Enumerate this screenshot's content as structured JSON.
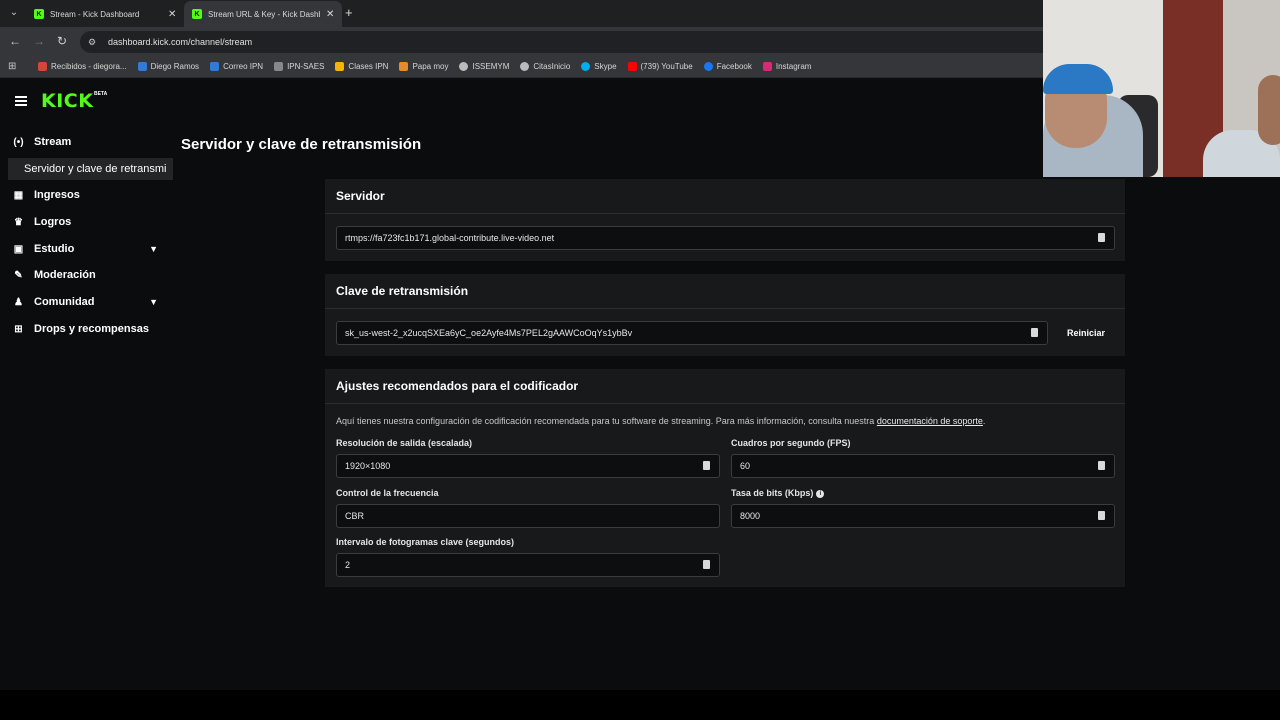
{
  "browser": {
    "tabs": [
      {
        "title": "Stream - Kick Dashboard",
        "active": false
      },
      {
        "title": "Stream URL & Key - Kick Dashb",
        "active": true
      }
    ],
    "url": "dashboard.kick.com/channel/stream",
    "bookmarks": [
      {
        "label": "Recibidos - diegora...",
        "color": "#d44638"
      },
      {
        "label": "Diego Ramos",
        "color": "#2f7bd6"
      },
      {
        "label": "Correo IPN",
        "color": "#2f7bd6"
      },
      {
        "label": "IPN-SAES",
        "color": "#888888"
      },
      {
        "label": "Clases IPN",
        "color": "#f4b400"
      },
      {
        "label": "Papa moy",
        "color": "#e58b2a"
      },
      {
        "label": "ISSEMYM",
        "color": "#bbbbbb"
      },
      {
        "label": "CitasInicio",
        "color": "#bbbbbb"
      },
      {
        "label": "Skype",
        "color": "#00aff0"
      },
      {
        "label": "(739) YouTube",
        "color": "#ff0000"
      },
      {
        "label": "Facebook",
        "color": "#1877f2"
      },
      {
        "label": "Instagram",
        "color": "#d62976"
      }
    ]
  },
  "kick": {
    "logo": "KICK",
    "logo_badge": "BETA",
    "sidebar": {
      "items": [
        {
          "label": "Stream",
          "icon": "broadcast-icon",
          "glyph": "(•)"
        },
        {
          "label": "Ingresos",
          "icon": "chart-icon",
          "glyph": "▦"
        },
        {
          "label": "Logros",
          "icon": "trophy-icon",
          "glyph": "♛"
        },
        {
          "label": "Estudio",
          "icon": "studio-icon",
          "glyph": "▣"
        },
        {
          "label": "Moderación",
          "icon": "wrench-icon",
          "glyph": "✎"
        },
        {
          "label": "Comunidad",
          "icon": "community-icon",
          "glyph": "♟"
        },
        {
          "label": "Drops y recompensas",
          "icon": "drops-icon",
          "glyph": "⊞"
        }
      ],
      "sub_item": "Servidor y clave de retransmi"
    },
    "page_title": "Servidor y clave de retransmisión",
    "server": {
      "title": "Servidor",
      "value": "rtmps://fa723fc1b171.global-contribute.live-video.net"
    },
    "stream_key": {
      "title": "Clave de retransmisión",
      "value": "sk_us-west-2_x2ucqSXEa6yC_oe2Ayfe4Ms7PEL2gAAWCoOqYs1ybBv",
      "reset_label": "Reiniciar"
    },
    "encoder": {
      "title": "Ajustes recomendados para el codificador",
      "description": "Aquí tienes nuestra configuración de codificación recomendada para tu software de streaming. Para más información, consulta nuestra ",
      "link": "documentación de soporte",
      "period": ".",
      "resolution_label": "Resolución de salida (escalada)",
      "resolution_value": "1920×1080",
      "fps_label": "Cuadros por segundo (FPS)",
      "fps_value": "60",
      "rate_control_label": "Control de la frecuencia",
      "rate_control_value": "CBR",
      "bitrate_label": "Tasa de bits (Kbps)",
      "bitrate_value": "8000",
      "keyframe_label": "Intervalo de fotogramas clave (segundos)",
      "keyframe_value": "2"
    }
  },
  "colors": {
    "brand": "#53fc18",
    "background": "#0b0c0d",
    "card": "#18191b"
  }
}
